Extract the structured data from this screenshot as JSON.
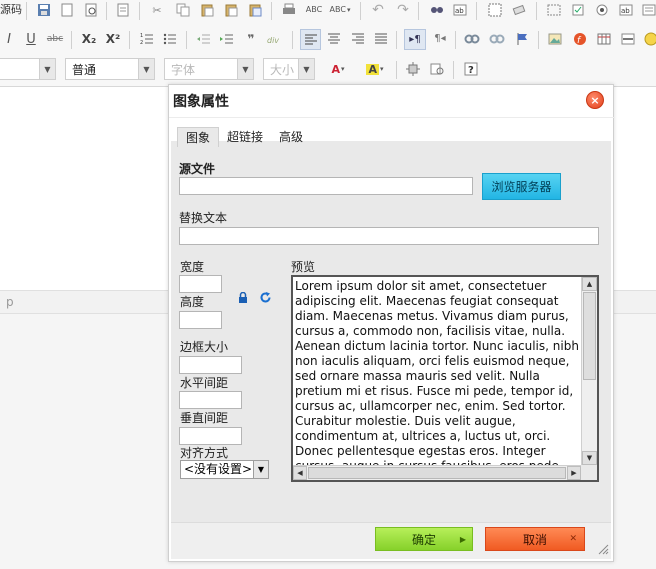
{
  "toolbar": {
    "row1": {
      "source_label": "源码",
      "icons": [
        "save-icon",
        "new-page-icon",
        "preview-icon",
        "template-icon",
        "cut-icon",
        "copy-icon",
        "paste-icon",
        "paste-text-icon",
        "paste-word-icon",
        "print-icon",
        "spellcheck-icon",
        "spellcheck-as-you-type-icon",
        "undo-icon",
        "redo-icon",
        "find-icon",
        "replace-icon",
        "select-all-icon",
        "remove-format-icon",
        "form-icon",
        "checkbox-icon",
        "radio-icon",
        "textfield-icon",
        "textarea-icon"
      ],
      "abc_label": "ABC"
    },
    "row2": {
      "italic": "I",
      "underline": "U",
      "strike": "abc",
      "subscript": "X₂",
      "superscript": "X²"
    },
    "row3": {
      "format_value": "普通",
      "font_placeholder": "字体",
      "size_placeholder": "大小"
    }
  },
  "editor": {
    "status_text": "p"
  },
  "dialog": {
    "title": "图象属性",
    "close_glyph": "×",
    "tabs": [
      {
        "label": "图象",
        "active": true
      },
      {
        "label": "超链接",
        "active": false
      },
      {
        "label": "高级",
        "active": false
      }
    ],
    "source_label": "源文件",
    "source_value": "",
    "browse_button": "浏览服务器",
    "alt_label": "替换文本",
    "alt_value": "",
    "width_label": "宽度",
    "height_label": "高度",
    "border_label": "边框大小",
    "hspace_label": "水平间距",
    "vspace_label": "垂直间距",
    "align_label": "对齐方式",
    "align_value": "<没有设置>",
    "preview_label": "预览",
    "preview_text": "Lorem ipsum dolor sit amet, consectetuer adipiscing elit. Maecenas feugiat consequat diam. Maecenas metus. Vivamus diam purus, cursus a, commodo non, facilisis vitae, nulla. Aenean dictum lacinia tortor. Nunc iaculis, nibh non iaculis aliquam, orci felis euismod neque, sed ornare massa mauris sed velit. Nulla pretium mi et risus. Fusce mi pede, tempor id, cursus ac, ullamcorper nec, enim. Sed tortor. Curabitur molestie. Duis velit augue, condimentum at, ultrices a, luctus ut, orci. Donec pellentesque egestas eros. Integer cursus, augue in cursus faucibus, eros pede bibendum sem, in tempus tellus justo quis ligula. Etiam eget tortor.",
    "ok_button": "确定",
    "cancel_button": "取消",
    "colors": {
      "browse": "#2bb9e6",
      "ok": "#98dd3a",
      "cancel": "#f26a30",
      "close": "#e84b22"
    }
  }
}
